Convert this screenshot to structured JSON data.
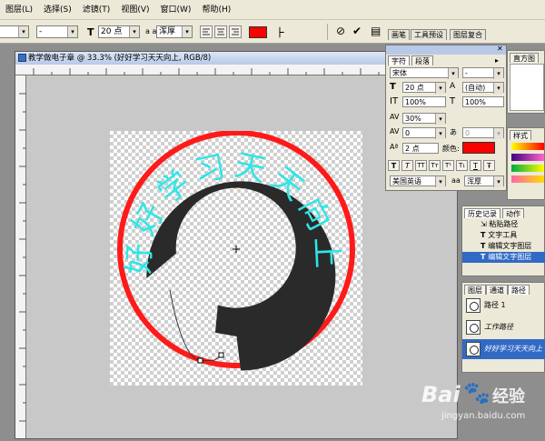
{
  "menubar": {
    "items": [
      "图层(L)",
      "选择(S)",
      "滤镜(T)",
      "视图(V)",
      "窗口(W)",
      "帮助(H)"
    ]
  },
  "options": {
    "style_value": "-",
    "size_value": "20 点",
    "aa_value": "浑厚",
    "text_color": "#ff0000",
    "tabs": [
      "画笔",
      "工具预设",
      "图层复合"
    ]
  },
  "document": {
    "title": "教学做电子章 @ 33.3% (好好学习天天向上, RGB/8)",
    "stamp_text": "好好学习天天向上",
    "stamp_ring_color": "#ff1a1a",
    "stamp_text_color": "#2ee6e6",
    "stamp_band_color": "#2a2a2a"
  },
  "char_panel": {
    "tabs": [
      "字符",
      "段落"
    ],
    "font_family": "宋体",
    "font_style": "-",
    "font_size": "20 点",
    "leading": "(自动)",
    "vertical_scale": "100%",
    "horizontal_scale": "100%",
    "tracking": "30%",
    "kerning": "0",
    "kerning2": "0",
    "baseline_shift": "2 点",
    "color_label": "颜色:",
    "color_value": "#ff0000",
    "style_buttons": [
      "T",
      "T",
      "TT",
      "Tт",
      "T¹",
      "T₁",
      "T",
      "Ŧ"
    ],
    "language": "美国英语",
    "aa_label": "aa",
    "aa_value": "浑厚"
  },
  "right_panels": {
    "nav_tab": "直方图",
    "styles_tab": "样式",
    "history_tabs": [
      "历史记录",
      "动作"
    ],
    "history_items": [
      "粘贴路径",
      "文字工具",
      "编辑文字图层",
      "编辑文字图层"
    ],
    "layers_tabs": [
      "图层",
      "通道",
      "路径"
    ],
    "path_items": [
      "路径 1",
      "工作路径",
      "好好学习天天向上"
    ]
  },
  "watermark": {
    "brand": "Bai",
    "brand2": "经验",
    "url": "jingyan.baidu.com"
  }
}
